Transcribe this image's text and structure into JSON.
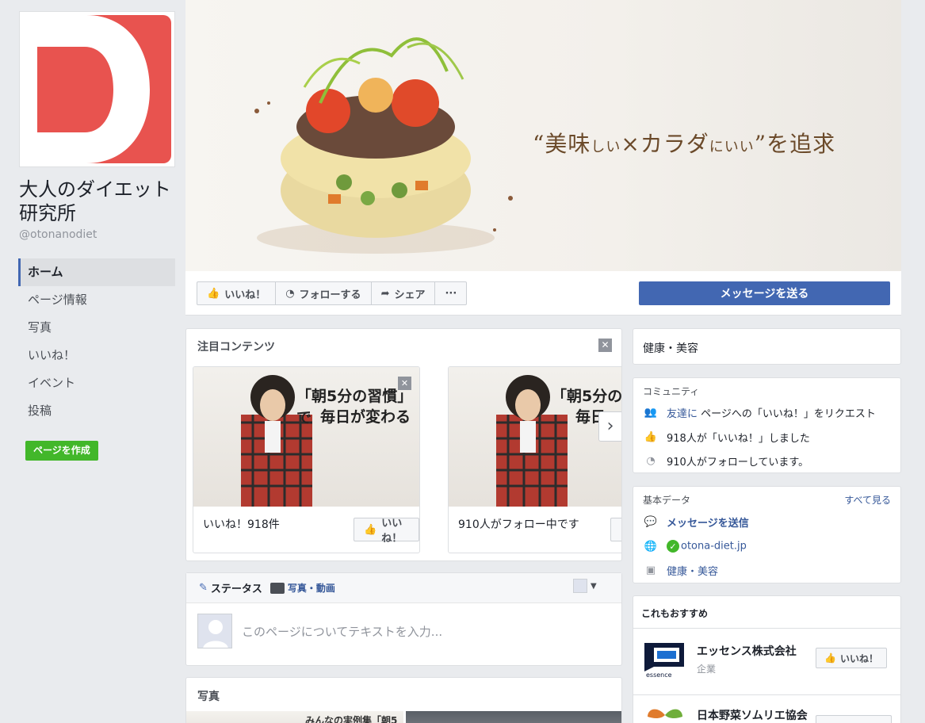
{
  "page": {
    "name": "大人のダイエット研究所",
    "handle": "@otonanodiet"
  },
  "nav": {
    "items": [
      "ホーム",
      "ページ情報",
      "写真",
      "いいね！",
      "イベント",
      "投稿"
    ],
    "active": "ホーム",
    "create_page": "ページを作成"
  },
  "cover": {
    "tagline_open": "“美味",
    "tagline_a": "しい",
    "tagline_b": "×カラダ",
    "tagline_c": "にいい",
    "tagline_d": "”を追求"
  },
  "actions": {
    "like": "いいね！",
    "follow": "フォローする",
    "share": "シェア",
    "more": "···",
    "message": "メッセージを送る"
  },
  "featured": {
    "title": "注目コンテンツ",
    "close": "✕",
    "items": [
      {
        "headline": "「朝5分の習慣」で",
        "headline2": "毎日が変わる",
        "caption": "いいね！918件",
        "button": "いいね！"
      },
      {
        "headline": "「朝5分の",
        "headline2": "毎日",
        "caption": "910人がフォロー中です",
        "button": ""
      }
    ],
    "next": "›"
  },
  "composer": {
    "tab_status": "ステータス",
    "tab_photo": "写真・動画",
    "placeholder": "このページについてテキストを入力..."
  },
  "photos": {
    "title": "写真",
    "strip_text": "みんなの実例集「朝5"
  },
  "category": {
    "text": "健康・美容"
  },
  "community": {
    "title": "コミュニティ",
    "invite_link": "友達に",
    "invite_text": "ページへの「いいね！」をリクエスト",
    "likes": "918人が「いいね！」しました",
    "follows": "910人がフォローしています。"
  },
  "basic": {
    "title": "基本データ",
    "see_all": "すべて見る",
    "message": "メッセージを送信",
    "website": "otona-diet.jp",
    "category": "健康・美容"
  },
  "recommend": {
    "title": "これもおすすめ",
    "items": [
      {
        "name": "エッセンス株式会社",
        "sub": "企業",
        "button": "いいね！",
        "logo_text": "essence"
      },
      {
        "name": "日本野菜ソムリエ協会",
        "sub": "",
        "button": ""
      }
    ]
  },
  "colors": {
    "brand_red": "#e8534f",
    "fb_blue": "#4267b2",
    "green": "#42b72a"
  }
}
